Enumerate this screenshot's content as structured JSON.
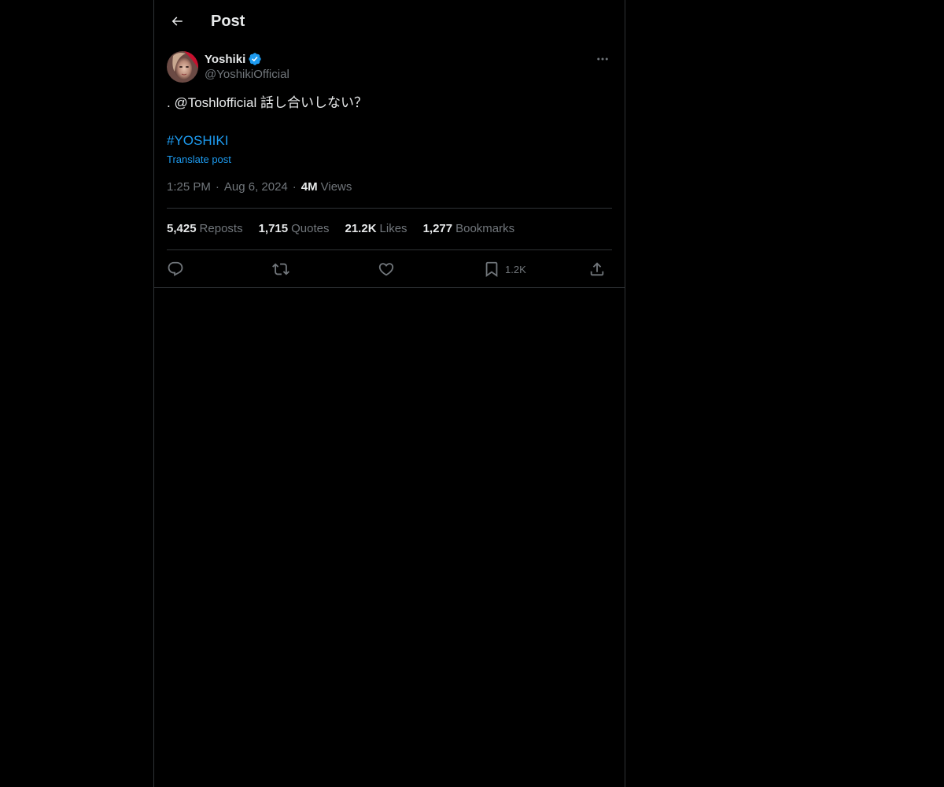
{
  "header": {
    "title": "Post"
  },
  "author": {
    "display_name": "Yoshiki",
    "handle": "@YoshikiOfficial",
    "verified": true
  },
  "post": {
    "text": ". @Toshlofficial 話し合いしない？",
    "hashtag": "#YOSHIKI",
    "translate_label": "Translate post",
    "time": "1:25 PM",
    "date": "Aug 6, 2024",
    "separator": "·",
    "views_count": "4M",
    "views_label": "Views"
  },
  "stats": [
    {
      "count": "5,425",
      "label": "Reposts"
    },
    {
      "count": "1,715",
      "label": "Quotes"
    },
    {
      "count": "21.2K",
      "label": "Likes"
    },
    {
      "count": "1,277",
      "label": "Bookmarks"
    }
  ],
  "actions": {
    "bookmark_count": "1.2K"
  },
  "colors": {
    "background": "#000000",
    "text_primary": "#e7e9ea",
    "text_secondary": "#71767b",
    "accent": "#1d9bf0",
    "border": "#2f3336",
    "verified": "#1d9bf0"
  },
  "icons": {
    "back": "arrow-left-icon",
    "verified": "verified-badge-icon",
    "more": "more-horizontal-icon",
    "reply": "reply-icon",
    "repost": "repost-icon",
    "like": "heart-icon",
    "bookmark": "bookmark-icon",
    "share": "share-icon"
  }
}
